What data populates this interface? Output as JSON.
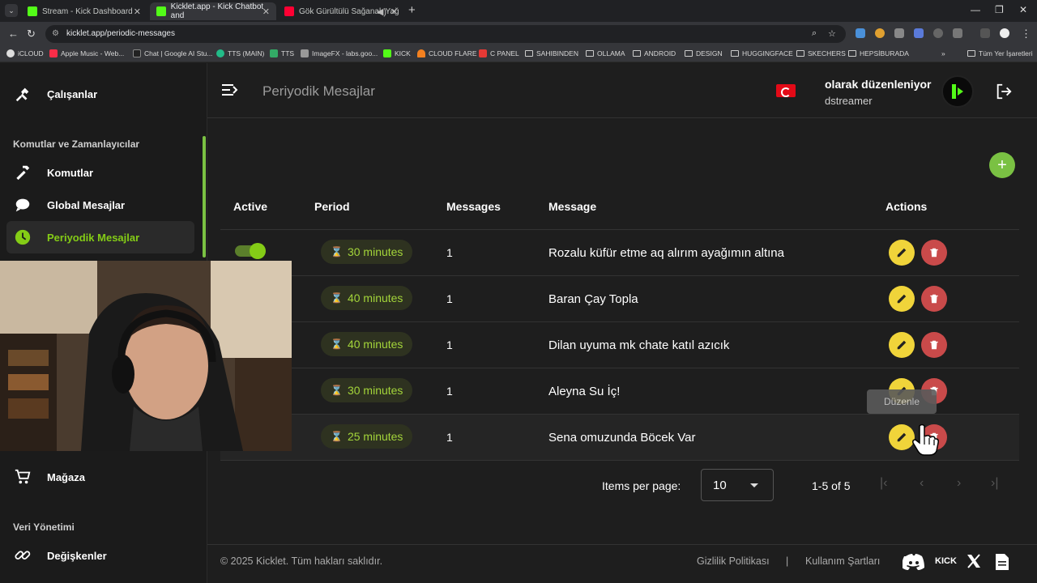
{
  "browser": {
    "tabs": [
      {
        "title": "Stream - Kick Dashboard",
        "favicon_color": "#53fc18"
      },
      {
        "title": "Kicklet.app - Kick Chatbot and",
        "favicon_color": "#53fc18"
      },
      {
        "title": "Gök Gürültülü Sağanak Yağ",
        "favicon_color": "#ff0033"
      }
    ],
    "url": "kicklet.app/periodic-messages",
    "bookmarks": [
      "iCLOUD",
      "Apple Music - Web...",
      "Chat | Google AI Stu...",
      "TTS (MAIN)",
      "TTS",
      "ImageFX - labs.goo...",
      "KICK",
      "CLOUD FLARE",
      "C PANEL",
      "SAHIBINDEN",
      "OLLAMA",
      "ANDROID",
      "DESIGN",
      "HUGGINGFACE",
      "SKECHERS",
      "HEPSİBURADA"
    ],
    "all_bookmarks": "Tüm Yer İşaretleri"
  },
  "sidebar": {
    "item_calisanlar": "Çalışanlar",
    "section_commands": "Komutlar ve Zamanlayıcılar",
    "item_komutlar": "Komutlar",
    "item_global": "Global Mesajlar",
    "item_periyodik": "Periyodik Mesajlar",
    "item_magaza": "Mağaza",
    "section_data": "Veri Yönetimi",
    "item_degiskenler": "Değişkenler"
  },
  "header": {
    "title": "Periyodik Mesajlar",
    "editing_as": "olarak düzenleniyor",
    "username": "dstreamer"
  },
  "table": {
    "columns": {
      "active": "Active",
      "period": "Period",
      "messages": "Messages",
      "message": "Message",
      "actions": "Actions"
    },
    "rows": [
      {
        "active": true,
        "period": "30 minutes",
        "count": "1",
        "message": "Rozalu küfür etme aq alırım ayağımın altına"
      },
      {
        "active": true,
        "period": "40 minutes",
        "count": "1",
        "message": "Baran Çay Topla"
      },
      {
        "active": true,
        "period": "40 minutes",
        "count": "1",
        "message": "Dilan uyuma mk chate katıl azıcık"
      },
      {
        "active": true,
        "period": "30 minutes",
        "count": "1",
        "message": "Aleyna Su İç!"
      },
      {
        "active": true,
        "period": "25 minutes",
        "count": "1",
        "message": "Sena omuzunda Böcek Var"
      }
    ],
    "tooltip": "Düzenle"
  },
  "pagination": {
    "items_per_page_label": "Items per page:",
    "items_per_page_value": "10",
    "range": "1-5 of 5"
  },
  "footer": {
    "copyright": "© 2025 Kicklet. Tüm hakları saklıdır.",
    "privacy": "Gizlilik Politikası",
    "separator": "|",
    "terms": "Kullanım Şartları",
    "kick_text": "KICK"
  },
  "colors": {
    "accent": "#84cc16",
    "edit": "#f0d43a",
    "delete": "#c94a4a"
  }
}
